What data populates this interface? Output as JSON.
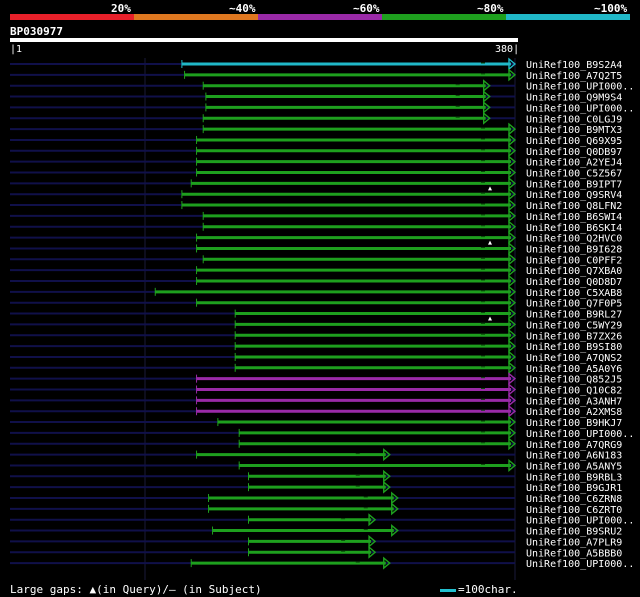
{
  "identity_legend": {
    "ranges": [
      {
        "label": "20%",
        "color": "#e8202a"
      },
      {
        "label": "~40%",
        "color": "#e07820"
      },
      {
        "label": "~60%",
        "color": "#9a2aa8"
      },
      {
        "label": "~80%",
        "color": "#1ea01e"
      },
      {
        "label": "~100%",
        "color": "#20b8c8"
      }
    ]
  },
  "query": {
    "id": "BP030977",
    "start": "1",
    "end": "380"
  },
  "hits": [
    {
      "label": "UniRef100_B9S2A4",
      "start": 130,
      "end": 380,
      "color": "#20b8c8",
      "gap": false
    },
    {
      "label": "UniRef100_A7Q2T5",
      "start": 132,
      "end": 380,
      "color": "#1ea01e",
      "gap": false
    },
    {
      "label": "UniRef100_UPI000..",
      "start": 146,
      "end": 361,
      "color": "#1ea01e",
      "gap": false
    },
    {
      "label": "UniRef100_Q9M9S4",
      "start": 148,
      "end": 361,
      "color": "#1ea01e",
      "gap": false
    },
    {
      "label": "UniRef100_UPI000..",
      "start": 148,
      "end": 361,
      "color": "#1ea01e",
      "gap": false
    },
    {
      "label": "UniRef100_C0LGJ9",
      "start": 146,
      "end": 361,
      "color": "#1ea01e",
      "gap": false
    },
    {
      "label": "UniRef100_B9MTX3",
      "start": 146,
      "end": 380,
      "color": "#1ea01e",
      "gap": false
    },
    {
      "label": "UniRef100_Q69X95",
      "start": 141,
      "end": 380,
      "color": "#1ea01e",
      "gap": false
    },
    {
      "label": "UniRef100_Q0DB97",
      "start": 141,
      "end": 380,
      "color": "#1ea01e",
      "gap": false
    },
    {
      "label": "UniRef100_A2YEJ4",
      "start": 141,
      "end": 380,
      "color": "#1ea01e",
      "gap": false
    },
    {
      "label": "UniRef100_C5Z567",
      "start": 141,
      "end": 380,
      "color": "#1ea01e",
      "gap": false
    },
    {
      "label": "UniRef100_B9IPT7",
      "start": 137,
      "end": 380,
      "color": "#1ea01e",
      "gap": true
    },
    {
      "label": "UniRef100_Q9SRV4",
      "start": 130,
      "end": 380,
      "color": "#1ea01e",
      "gap": false
    },
    {
      "label": "UniRef100_Q8LFN2",
      "start": 130,
      "end": 380,
      "color": "#1ea01e",
      "gap": false
    },
    {
      "label": "UniRef100_B6SWI4",
      "start": 146,
      "end": 380,
      "color": "#1ea01e",
      "gap": false
    },
    {
      "label": "UniRef100_B6SKI4",
      "start": 146,
      "end": 380,
      "color": "#1ea01e",
      "gap": false
    },
    {
      "label": "UniRef100_Q2HVC0",
      "start": 141,
      "end": 380,
      "color": "#1ea01e",
      "gap": true
    },
    {
      "label": "UniRef100_B9I628",
      "start": 141,
      "end": 380,
      "color": "#1ea01e",
      "gap": false
    },
    {
      "label": "UniRef100_C0PFF2",
      "start": 146,
      "end": 380,
      "color": "#1ea01e",
      "gap": false
    },
    {
      "label": "UniRef100_Q7XBA0",
      "start": 141,
      "end": 380,
      "color": "#1ea01e",
      "gap": false
    },
    {
      "label": "UniRef100_Q0D8D7",
      "start": 141,
      "end": 380,
      "color": "#1ea01e",
      "gap": false
    },
    {
      "label": "UniRef100_C5XAB8",
      "start": 110,
      "end": 380,
      "color": "#1ea01e",
      "gap": false
    },
    {
      "label": "UniRef100_Q7F0P5",
      "start": 141,
      "end": 380,
      "color": "#1ea01e",
      "gap": false
    },
    {
      "label": "UniRef100_B9RL27",
      "start": 170,
      "end": 380,
      "color": "#1ea01e",
      "gap": true
    },
    {
      "label": "UniRef100_C5WY29",
      "start": 170,
      "end": 380,
      "color": "#1ea01e",
      "gap": false
    },
    {
      "label": "UniRef100_B7ZX26",
      "start": 170,
      "end": 380,
      "color": "#1ea01e",
      "gap": false
    },
    {
      "label": "UniRef100_B9SI80",
      "start": 170,
      "end": 380,
      "color": "#1ea01e",
      "gap": false
    },
    {
      "label": "UniRef100_A7QNS2",
      "start": 170,
      "end": 380,
      "color": "#1ea01e",
      "gap": false
    },
    {
      "label": "UniRef100_A5A0Y6",
      "start": 170,
      "end": 380,
      "color": "#1ea01e",
      "gap": false
    },
    {
      "label": "UniRef100_Q852J5",
      "start": 141,
      "end": 380,
      "color": "#9a2aa8",
      "gap": false
    },
    {
      "label": "UniRef100_Q10C82",
      "start": 141,
      "end": 380,
      "color": "#9a2aa8",
      "gap": false
    },
    {
      "label": "UniRef100_A3ANH7",
      "start": 141,
      "end": 380,
      "color": "#9a2aa8",
      "gap": false
    },
    {
      "label": "UniRef100_A2XMS8",
      "start": 141,
      "end": 380,
      "color": "#9a2aa8",
      "gap": false
    },
    {
      "label": "UniRef100_B9HKJ7",
      "start": 157,
      "end": 380,
      "color": "#1ea01e",
      "gap": false
    },
    {
      "label": "UniRef100_UPI000..",
      "start": 173,
      "end": 380,
      "color": "#1ea01e",
      "gap": false
    },
    {
      "label": "UniRef100_A7QRG9",
      "start": 173,
      "end": 380,
      "color": "#1ea01e",
      "gap": false
    },
    {
      "label": "UniRef100_A6N183",
      "start": 141,
      "end": 286,
      "color": "#1ea01e",
      "gap": false
    },
    {
      "label": "UniRef100_A5ANY5",
      "start": 173,
      "end": 380,
      "color": "#1ea01e",
      "gap": false
    },
    {
      "label": "UniRef100_B9RBL3",
      "start": 180,
      "end": 286,
      "color": "#1ea01e",
      "gap": false
    },
    {
      "label": "UniRef100_B9GJR1",
      "start": 180,
      "end": 286,
      "color": "#1ea01e",
      "gap": false
    },
    {
      "label": "UniRef100_C6ZRN8",
      "start": 150,
      "end": 292,
      "color": "#1ea01e",
      "gap": false
    },
    {
      "label": "UniRef100_C6ZRT0",
      "start": 150,
      "end": 292,
      "color": "#1ea01e",
      "gap": false
    },
    {
      "label": "UniRef100_UPI000..",
      "start": 180,
      "end": 275,
      "color": "#1ea01e",
      "gap": false
    },
    {
      "label": "UniRef100_B9SRU2",
      "start": 153,
      "end": 292,
      "color": "#1ea01e",
      "gap": false
    },
    {
      "label": "UniRef100_A7PLR9",
      "start": 180,
      "end": 275,
      "color": "#1ea01e",
      "gap": false
    },
    {
      "label": "UniRef100_A5BBB0",
      "start": 180,
      "end": 275,
      "color": "#1ea01e",
      "gap": false
    },
    {
      "label": "UniRef100_UPI000..",
      "start": 137,
      "end": 286,
      "color": "#1ea01e",
      "gap": false
    }
  ],
  "footer": {
    "gaps_text": "Large gaps: ▲(in Query)/– (in Subject)",
    "scale_text": "=100char."
  }
}
